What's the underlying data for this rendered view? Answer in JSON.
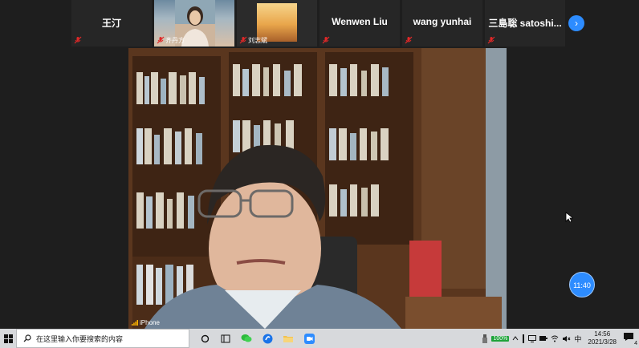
{
  "participants": [
    {
      "type": "name",
      "name": "王汀"
    },
    {
      "type": "video",
      "name": "(cut) 方",
      "caption": "齐丹方"
    },
    {
      "type": "video",
      "name": "",
      "caption": "刘志斌"
    },
    {
      "type": "name",
      "name": "Wenwen Liu"
    },
    {
      "type": "name",
      "name": "wang yunhai"
    },
    {
      "type": "name",
      "name": "三島聡 satoshi..."
    }
  ],
  "strip": {
    "next_label": "›"
  },
  "main": {
    "device_label": "iPhone"
  },
  "timer": {
    "value": "11:40"
  },
  "taskbar": {
    "search_placeholder": "在这里输入你要搜索的内容",
    "battery": "100%",
    "ime": "中",
    "time": "14:56",
    "date": "2021/3/28",
    "notification_count": "4"
  },
  "colors": {
    "accent": "#2d8cff",
    "muted": "#e02828"
  }
}
